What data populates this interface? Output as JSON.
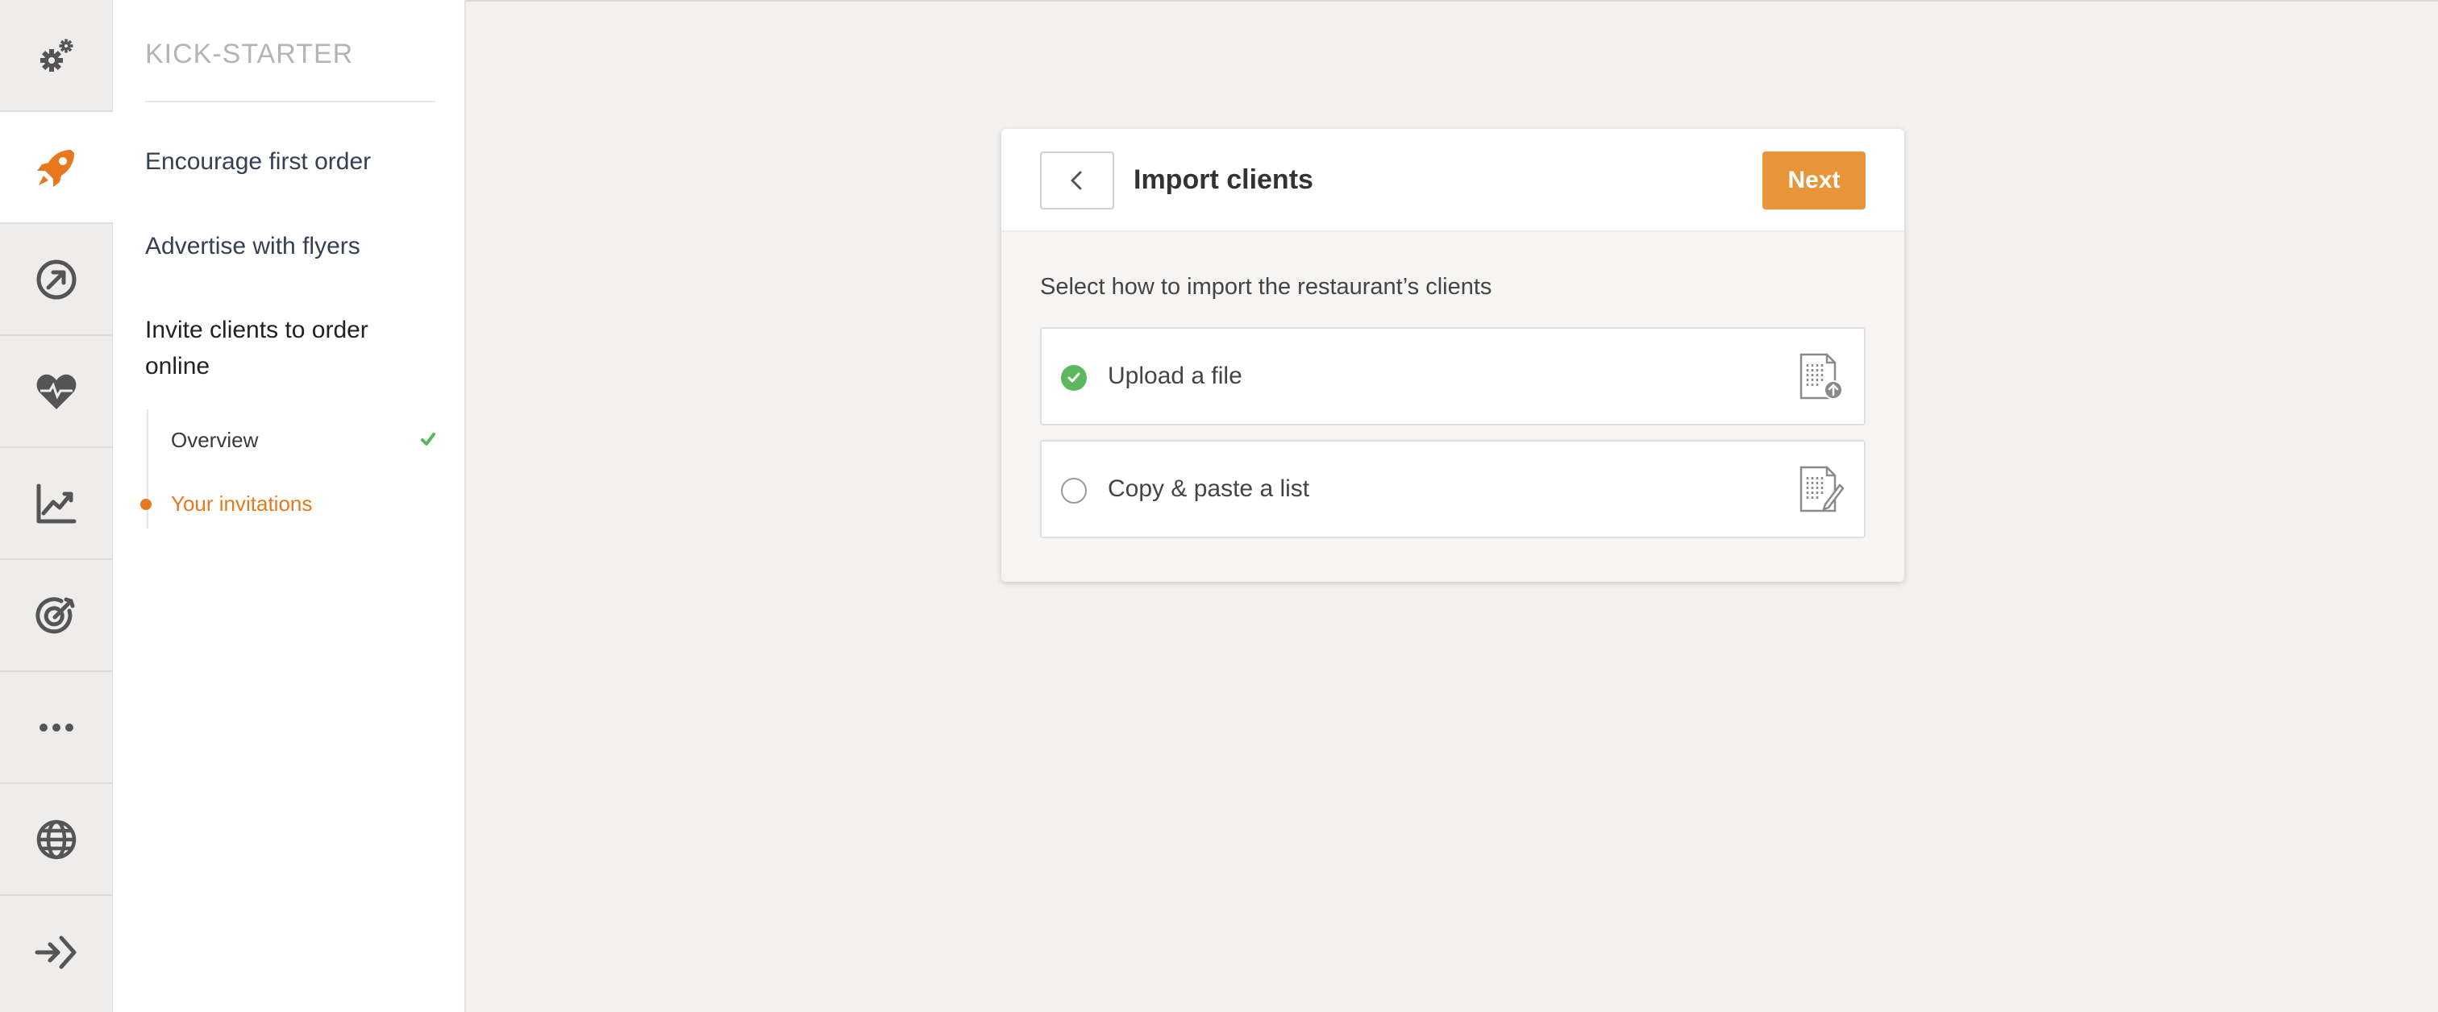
{
  "rail": {
    "items": [
      {
        "name": "settings-gears-icon"
      },
      {
        "name": "rocket-icon"
      },
      {
        "name": "compass-arrow-icon"
      },
      {
        "name": "heart-pulse-icon"
      },
      {
        "name": "line-chart-icon"
      },
      {
        "name": "target-icon"
      },
      {
        "name": "more-dots-icon"
      },
      {
        "name": "globe-icon"
      },
      {
        "name": "logout-arrow-icon"
      }
    ],
    "active_color": "#e8781e"
  },
  "panel": {
    "title": "KICK-STARTER",
    "links": [
      {
        "label": "Encourage first order"
      },
      {
        "label": "Advertise with flyers"
      },
      {
        "label": "Invite clients to order online"
      }
    ],
    "subitems": [
      {
        "label": "Overview",
        "state": "done"
      },
      {
        "label": "Your invitations",
        "state": "current"
      }
    ]
  },
  "card": {
    "title": "Import clients",
    "next_label": "Next",
    "instruction": "Select how to import the restaurant’s clients",
    "options": [
      {
        "label": "Upload a file",
        "selected": true,
        "icon": "file-upload-icon"
      },
      {
        "label": "Copy & paste a list",
        "selected": false,
        "icon": "file-edit-icon"
      }
    ]
  },
  "colors": {
    "accent": "#e8781e",
    "next_button": "#e8953a",
    "success": "#5cb85c"
  }
}
